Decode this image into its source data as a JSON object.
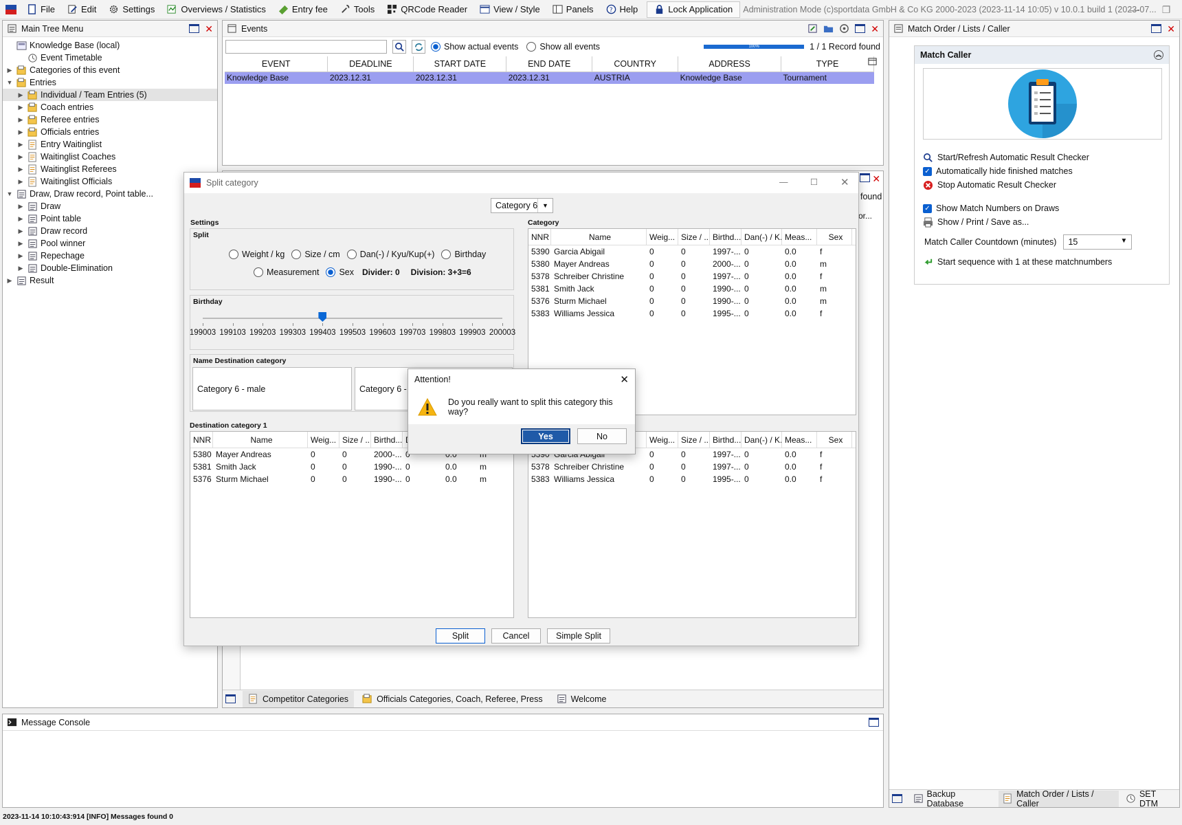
{
  "menu": {
    "items": [
      {
        "label": "File",
        "icon": "file-icon"
      },
      {
        "label": "Edit",
        "icon": "edit-icon"
      },
      {
        "label": "Settings",
        "icon": "gear-icon"
      },
      {
        "label": "Overviews / Statistics",
        "icon": "overview-icon"
      },
      {
        "label": "Entry fee",
        "icon": "money-icon"
      },
      {
        "label": "Tools",
        "icon": "wrench-icon"
      },
      {
        "label": "QRCode Reader",
        "icon": "qrcode-icon"
      },
      {
        "label": "View / Style",
        "icon": "view-icon"
      },
      {
        "label": "Panels",
        "icon": "panels-icon"
      },
      {
        "label": "Help",
        "icon": "help-icon"
      }
    ],
    "lock": "Lock Application",
    "admin": "Administration Mode (c)sportdata GmbH & Co KG 2000-2023 (2023-11-14 10:05)  v 10.0.1 build 1 (2023-07..."
  },
  "tree": {
    "title": "Main Tree Menu",
    "items": [
      {
        "label": "Knowledge Base (local)",
        "indent": 0,
        "arrow": "",
        "icon": "db"
      },
      {
        "label": "Event Timetable",
        "indent": 1,
        "arrow": "",
        "icon": "clock"
      },
      {
        "label": "Categories of this event",
        "indent": 0,
        "arrow": "▶",
        "icon": "folder"
      },
      {
        "label": "Entries",
        "indent": 0,
        "arrow": "▼",
        "icon": "folder"
      },
      {
        "label": "Individual / Team Entries (5)",
        "indent": 1,
        "arrow": "▶",
        "icon": "folder",
        "sel": true
      },
      {
        "label": "Coach entries",
        "indent": 1,
        "arrow": "▶",
        "icon": "folder"
      },
      {
        "label": "Referee entries",
        "indent": 1,
        "arrow": "▶",
        "icon": "folder"
      },
      {
        "label": "Officials entries",
        "indent": 1,
        "arrow": "▶",
        "icon": "folder"
      },
      {
        "label": "Entry Waitinglist",
        "indent": 1,
        "arrow": "▶",
        "icon": "list"
      },
      {
        "label": "Waitinglist Coaches",
        "indent": 1,
        "arrow": "▶",
        "icon": "list"
      },
      {
        "label": "Waitinglist Referees",
        "indent": 1,
        "arrow": "▶",
        "icon": "list"
      },
      {
        "label": "Waitinglist Officials",
        "indent": 1,
        "arrow": "▶",
        "icon": "list"
      },
      {
        "label": "Draw, Draw record, Point table...",
        "indent": 0,
        "arrow": "▼",
        "icon": "doc"
      },
      {
        "label": "Draw",
        "indent": 1,
        "arrow": "▶",
        "icon": "doc"
      },
      {
        "label": "Point table",
        "indent": 1,
        "arrow": "▶",
        "icon": "doc"
      },
      {
        "label": "Draw record",
        "indent": 1,
        "arrow": "▶",
        "icon": "doc"
      },
      {
        "label": "Pool winner",
        "indent": 1,
        "arrow": "▶",
        "icon": "doc"
      },
      {
        "label": "Repechage",
        "indent": 1,
        "arrow": "▶",
        "icon": "doc"
      },
      {
        "label": "Double-Elimination",
        "indent": 1,
        "arrow": "▶",
        "icon": "doc"
      },
      {
        "label": "Result",
        "indent": 0,
        "arrow": "▶",
        "icon": "doc"
      }
    ]
  },
  "events": {
    "title": "Events",
    "search_value": "",
    "show_actual": "Show actual events",
    "show_all": "Show all events",
    "progress": "100%",
    "found": "1 / 1 Record found",
    "columns": [
      "EVENT",
      "DEADLINE",
      "START DATE",
      "END DATE",
      "COUNTRY",
      "ADDRESS",
      "TYPE"
    ],
    "rows": [
      [
        "Knowledge Base",
        "2023.12.31",
        "2023.12.31",
        "2023.12.31",
        "AUSTRIA",
        "Knowledge Base",
        "Tournament"
      ]
    ]
  },
  "bg_panel": {
    "found": "found",
    "col": "or..."
  },
  "bottom_tabs": [
    "Competitor Categories",
    "Officials Categories, Coach, Referee, Press",
    "Welcome"
  ],
  "split": {
    "title": "Split category",
    "category": "Category 6",
    "settings_label": "Settings",
    "split_label": "Split",
    "radios": [
      {
        "label": "Weight / kg",
        "on": false
      },
      {
        "label": "Size / cm",
        "on": false
      },
      {
        "label": "Dan(-) / Kyu/Kup(+)",
        "on": false
      },
      {
        "label": "Birthday",
        "on": false
      },
      {
        "label": "Measurement",
        "on": false
      },
      {
        "label": "Sex",
        "on": true
      }
    ],
    "divider": "Divider: 0",
    "division": "Division: 3+3=6",
    "birthday_label": "Birthday",
    "slider_position": 0.4,
    "slider_ticks": [
      "199003",
      "199103",
      "199203",
      "199303",
      "199403",
      "199503",
      "199603",
      "199703",
      "199803",
      "199903",
      "200003"
    ],
    "name_dest_label": "Name Destination category",
    "dest_name1": "Category 6 - male",
    "dest_name2": "Category 6 - f",
    "dest1_label": "Destination category 1",
    "category_label": "Category",
    "columns": [
      "NNR",
      "Name",
      "Weig...",
      "Size / ...",
      "Birthd...",
      "Dan(-) / K...",
      "Meas...",
      "Sex"
    ],
    "category_rows": [
      [
        "5390",
        "Garcia Abigail",
        "0",
        "0",
        "1997-...",
        "0",
        "0.0",
        "f"
      ],
      [
        "5380",
        "Mayer Andreas",
        "0",
        "0",
        "2000-...",
        "0",
        "0.0",
        "m"
      ],
      [
        "5378",
        "Schreiber Christine",
        "0",
        "0",
        "1997-...",
        "0",
        "0.0",
        "f"
      ],
      [
        "5381",
        "Smith Jack",
        "0",
        "0",
        "1990-...",
        "0",
        "0.0",
        "m"
      ],
      [
        "5376",
        "Sturm Michael",
        "0",
        "0",
        "1990-...",
        "0",
        "0.0",
        "m"
      ],
      [
        "5383",
        "Williams Jessica",
        "0",
        "0",
        "1995-...",
        "0",
        "0.0",
        "f"
      ]
    ],
    "dest1_rows": [
      [
        "5380",
        "Mayer Andreas",
        "0",
        "0",
        "2000-...",
        "0",
        "0.0",
        "m"
      ],
      [
        "5381",
        "Smith Jack",
        "0",
        "0",
        "1990-...",
        "0",
        "0.0",
        "m"
      ],
      [
        "5376",
        "Sturm Michael",
        "0",
        "0",
        "1990-...",
        "0",
        "0.0",
        "m"
      ]
    ],
    "dest2_rows": [
      [
        "5390",
        "Garcia Abigail",
        "0",
        "0",
        "1997-...",
        "0",
        "0.0",
        "f"
      ],
      [
        "5378",
        "Schreiber Christine",
        "0",
        "0",
        "1997-...",
        "0",
        "0.0",
        "f"
      ],
      [
        "5383",
        "Williams Jessica",
        "0",
        "0",
        "1995-...",
        "0",
        "0.0",
        "f"
      ]
    ],
    "btn_split": "Split",
    "btn_cancel": "Cancel",
    "btn_simple": "Simple Split"
  },
  "attention": {
    "title": "Attention!",
    "message": "Do you really want to split this category this way?",
    "yes": "Yes",
    "no": "No"
  },
  "caller": {
    "title": "Match Order / Lists / Caller",
    "section": "Match Caller",
    "items": [
      {
        "label": "Start/Refresh Automatic Result Checker",
        "icon": "search-icon"
      },
      {
        "label": "Automatically hide finished matches",
        "icon": "checkbox-icon"
      },
      {
        "label": "Stop Automatic Result Checker",
        "icon": "stop-icon"
      }
    ],
    "items2": [
      {
        "label": "Show Match Numbers on Draws",
        "icon": "checkbox-icon"
      },
      {
        "label": "Show / Print / Save as...",
        "icon": "print-icon"
      }
    ],
    "countdown_label": "Match Caller Countdown (minutes)",
    "countdown_value": "15",
    "sequence": "Start sequence with 1 at these matchnumbers",
    "tabs": [
      "Backup Database",
      "Match Order / Lists / Caller",
      "SET DTM"
    ]
  },
  "console": {
    "title": "Message Console"
  },
  "status": "2023-11-14 10:10:43:914 [INFO] Messages found 0",
  "colors": {
    "selection": "#9b9ef0",
    "accent": "#0a5fd0",
    "yes_button": "#1f5aa8"
  }
}
